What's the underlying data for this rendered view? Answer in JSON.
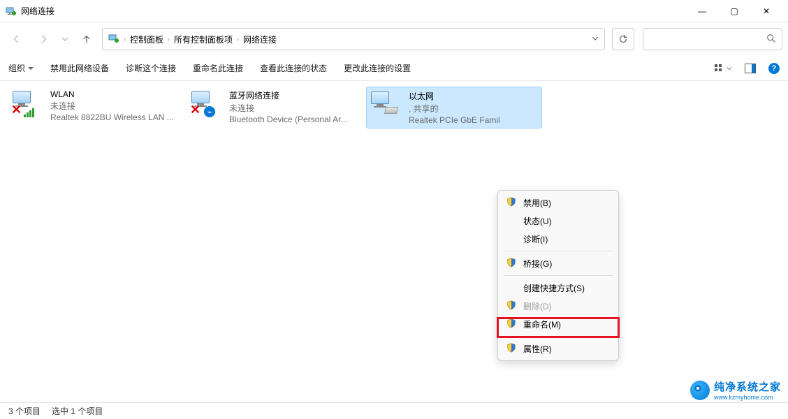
{
  "window": {
    "title": "网络连接",
    "min": "—",
    "max": "▢",
    "close": "✕"
  },
  "breadcrumb": {
    "root": "控制面板",
    "mid": "所有控制面板项",
    "leaf": "网络连接",
    "sep": "›"
  },
  "toolbar": {
    "organize": "组织",
    "disable": "禁用此网络设备",
    "diagnose": "诊断这个连接",
    "rename": "重命名此连接",
    "status": "查看此连接的状态",
    "settings": "更改此连接的设置"
  },
  "connections": [
    {
      "name": "WLAN",
      "status": "未连接",
      "device": "Realtek 8822BU Wireless LAN ..."
    },
    {
      "name": "蓝牙网络连接",
      "status": "未连接",
      "device": "Bluetooth Device (Personal Ar..."
    },
    {
      "name": "以太网",
      "status": ", 共享的",
      "device": "Realtek PCIe GbE Famil"
    }
  ],
  "context_menu": {
    "disable": "禁用(B)",
    "status": "状态(U)",
    "diagnose": "诊断(I)",
    "bridge": "桥接(G)",
    "shortcut": "创建快捷方式(S)",
    "delete": "删除(D)",
    "rename": "重命名(M)",
    "properties": "属性(R)"
  },
  "statusbar": {
    "count": "3 个项目",
    "selected": "选中 1 个项目"
  },
  "watermark": {
    "cn": "纯净系统之家",
    "en": "www.kzmyhome.com"
  }
}
